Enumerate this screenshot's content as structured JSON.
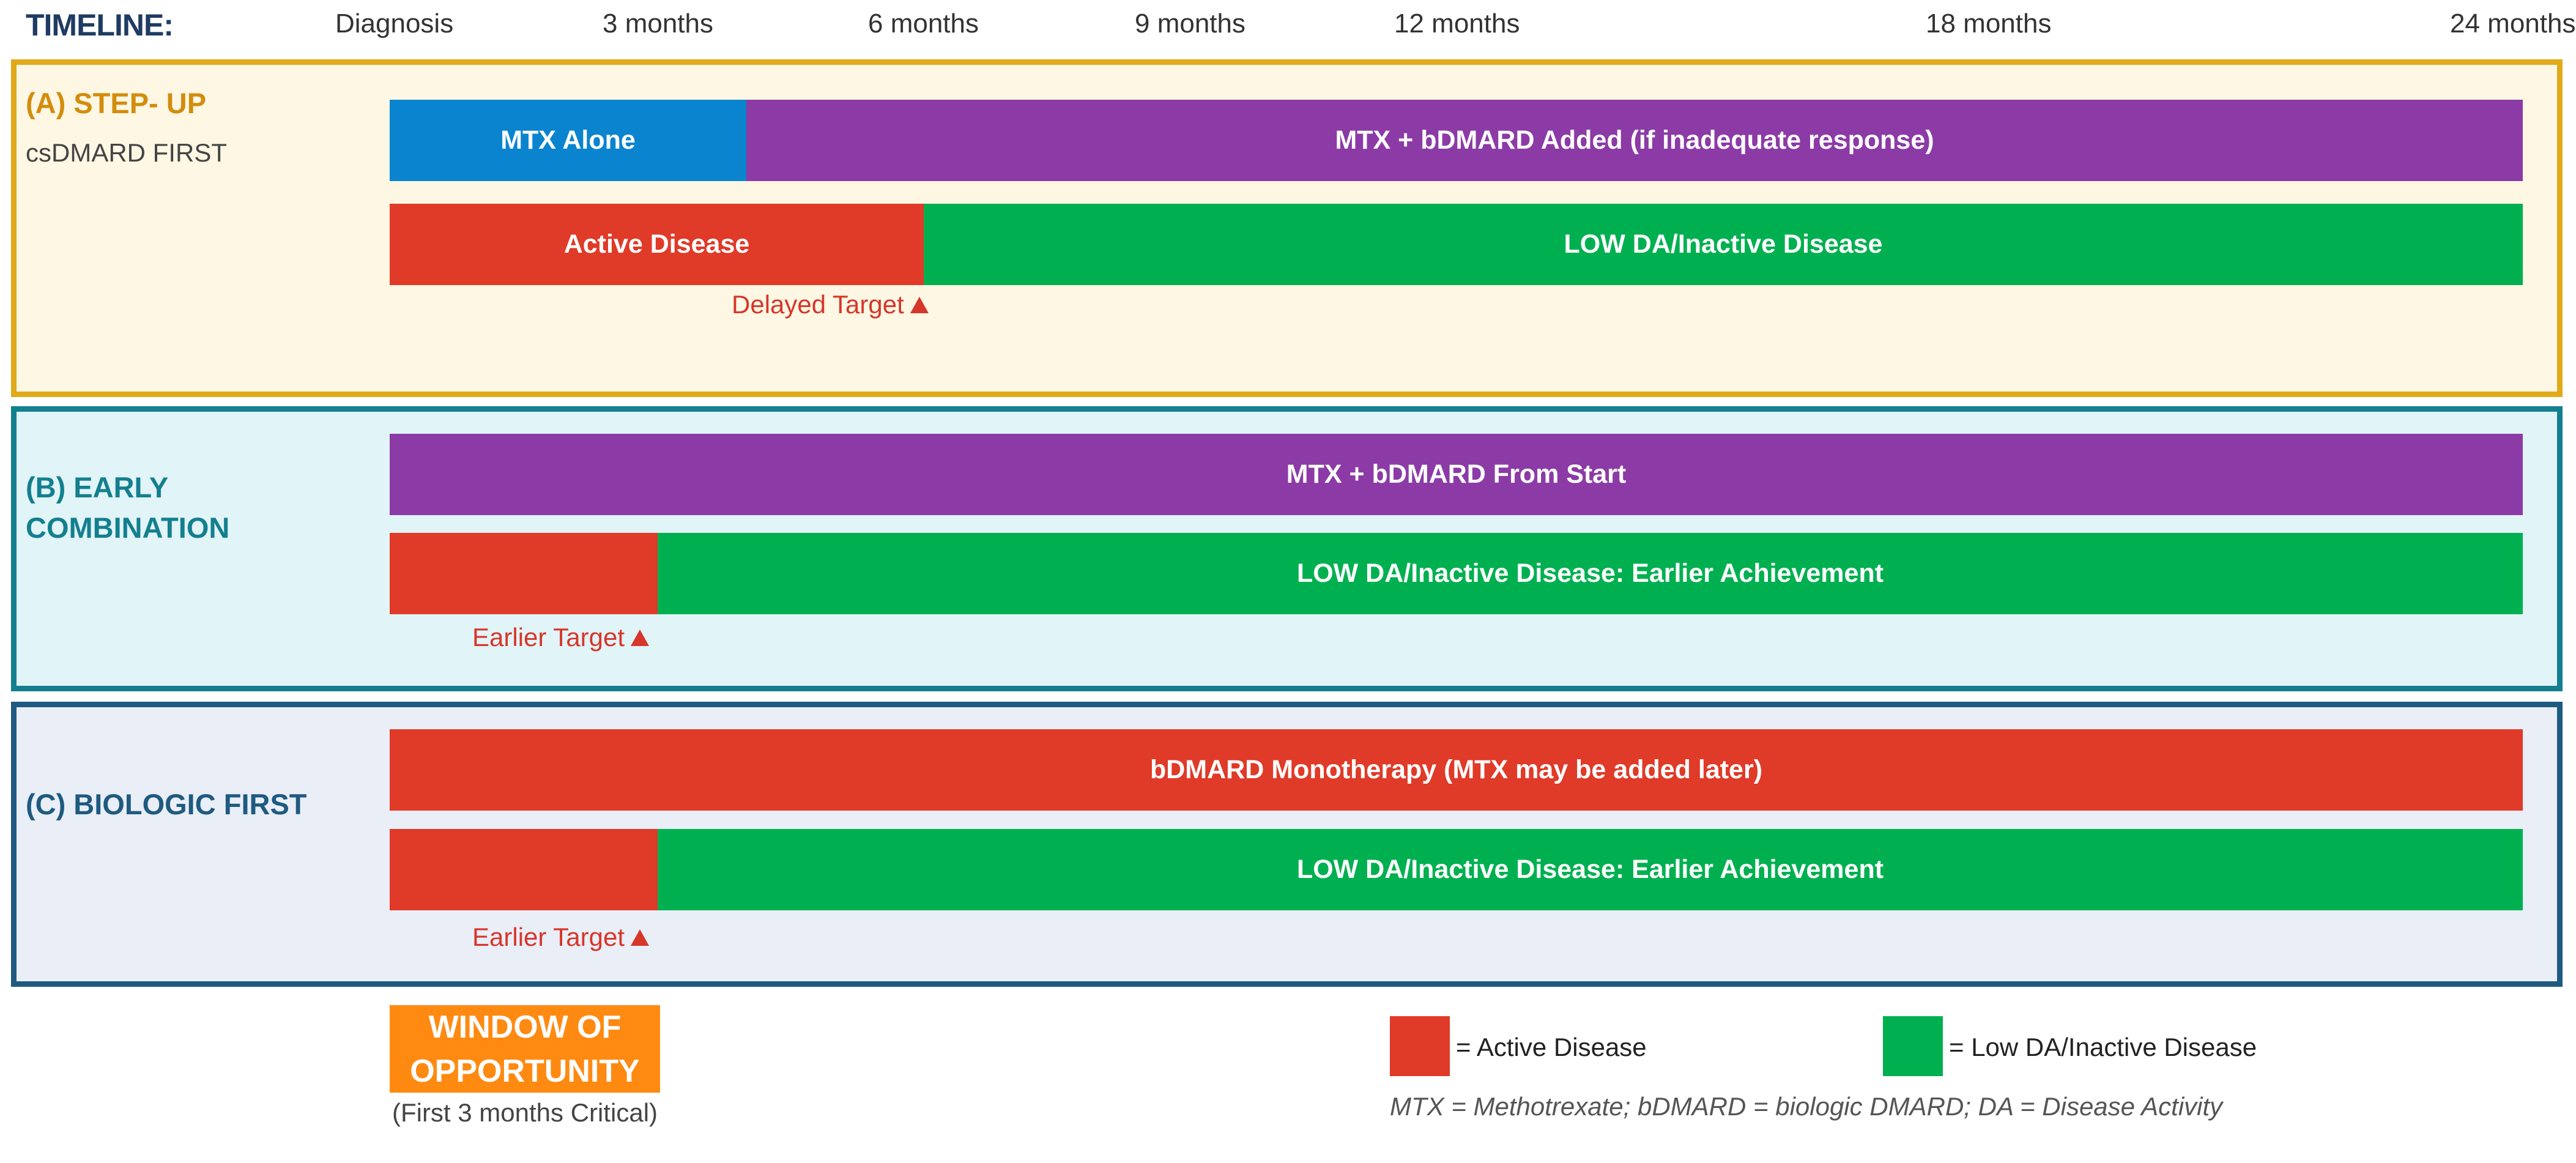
{
  "colors": {
    "blue": "#0a84cf",
    "purple": "#8c3ba6",
    "red": "#e03a28",
    "green": "#00b050",
    "orange": "#ff8a12",
    "panel_a_border": "#e0aa1a",
    "panel_a_bg": "#fef7e4",
    "panel_b_border": "#137f8f",
    "panel_b_bg": "#e1f4f7",
    "panel_c_border": "#1f5a80",
    "panel_c_bg": "#e9eef7"
  },
  "timeline": {
    "title": "TIMELINE:",
    "ticks": [
      {
        "label": "Diagnosis",
        "month": 0
      },
      {
        "label": "3 months",
        "month": 3
      },
      {
        "label": "6 months",
        "month": 6
      },
      {
        "label": "9 months",
        "month": 9
      },
      {
        "label": "12 months",
        "month": 12
      },
      {
        "label": "18 months",
        "month": 18
      },
      {
        "label": "24 months",
        "month": 24
      }
    ]
  },
  "panels": [
    {
      "title": "(A) STEP- UP",
      "subtitle": "csDMARD FIRST",
      "therapy": [
        {
          "label": "MTX Alone",
          "start": 0,
          "end": 4,
          "color": "blue"
        },
        {
          "label": "MTX + bDMARD Added (if inadequate response)",
          "start": 4,
          "end": 24,
          "color": "purple"
        }
      ],
      "disease": [
        {
          "label": "Active Disease",
          "start": 0,
          "end": 6,
          "color": "red"
        },
        {
          "label": "LOW DA/Inactive Disease",
          "start": 6,
          "end": 24,
          "color": "green"
        }
      ],
      "target": {
        "label": "Delayed Target",
        "month": 6
      }
    },
    {
      "title": "(B) EARLY COMBINATION",
      "subtitle": "",
      "therapy": [
        {
          "label": "MTX + bDMARD From Start",
          "start": 0,
          "end": 24,
          "color": "purple"
        }
      ],
      "disease": [
        {
          "label": "",
          "start": 0,
          "end": 3,
          "color": "red"
        },
        {
          "label": "LOW DA/Inactive Disease: Earlier Achievement",
          "start": 3,
          "end": 24,
          "color": "green"
        }
      ],
      "target": {
        "label": "Earlier Target",
        "month": 3
      }
    },
    {
      "title": "(C) BIOLOGIC FIRST",
      "subtitle": "",
      "therapy": [
        {
          "label": "bDMARD Monotherapy (MTX may be added later)",
          "start": 0,
          "end": 24,
          "color": "red"
        }
      ],
      "disease": [
        {
          "label": "",
          "start": 0,
          "end": 3,
          "color": "red"
        },
        {
          "label": "LOW DA/Inactive Disease: Earlier Achievement",
          "start": 3,
          "end": 24,
          "color": "green"
        }
      ],
      "target": {
        "label": "Earlier Target",
        "month": 3
      }
    }
  ],
  "window": {
    "label": "WINDOW OF OPPORTUNITY",
    "note": "(First 3 months Critical)"
  },
  "legend": {
    "active_label": "= Active Disease",
    "low_label": "= Low DA/Inactive Disease",
    "abbreviations": "MTX = Methotrexate; bDMARD = biologic DMARD; DA = Disease Activity"
  }
}
